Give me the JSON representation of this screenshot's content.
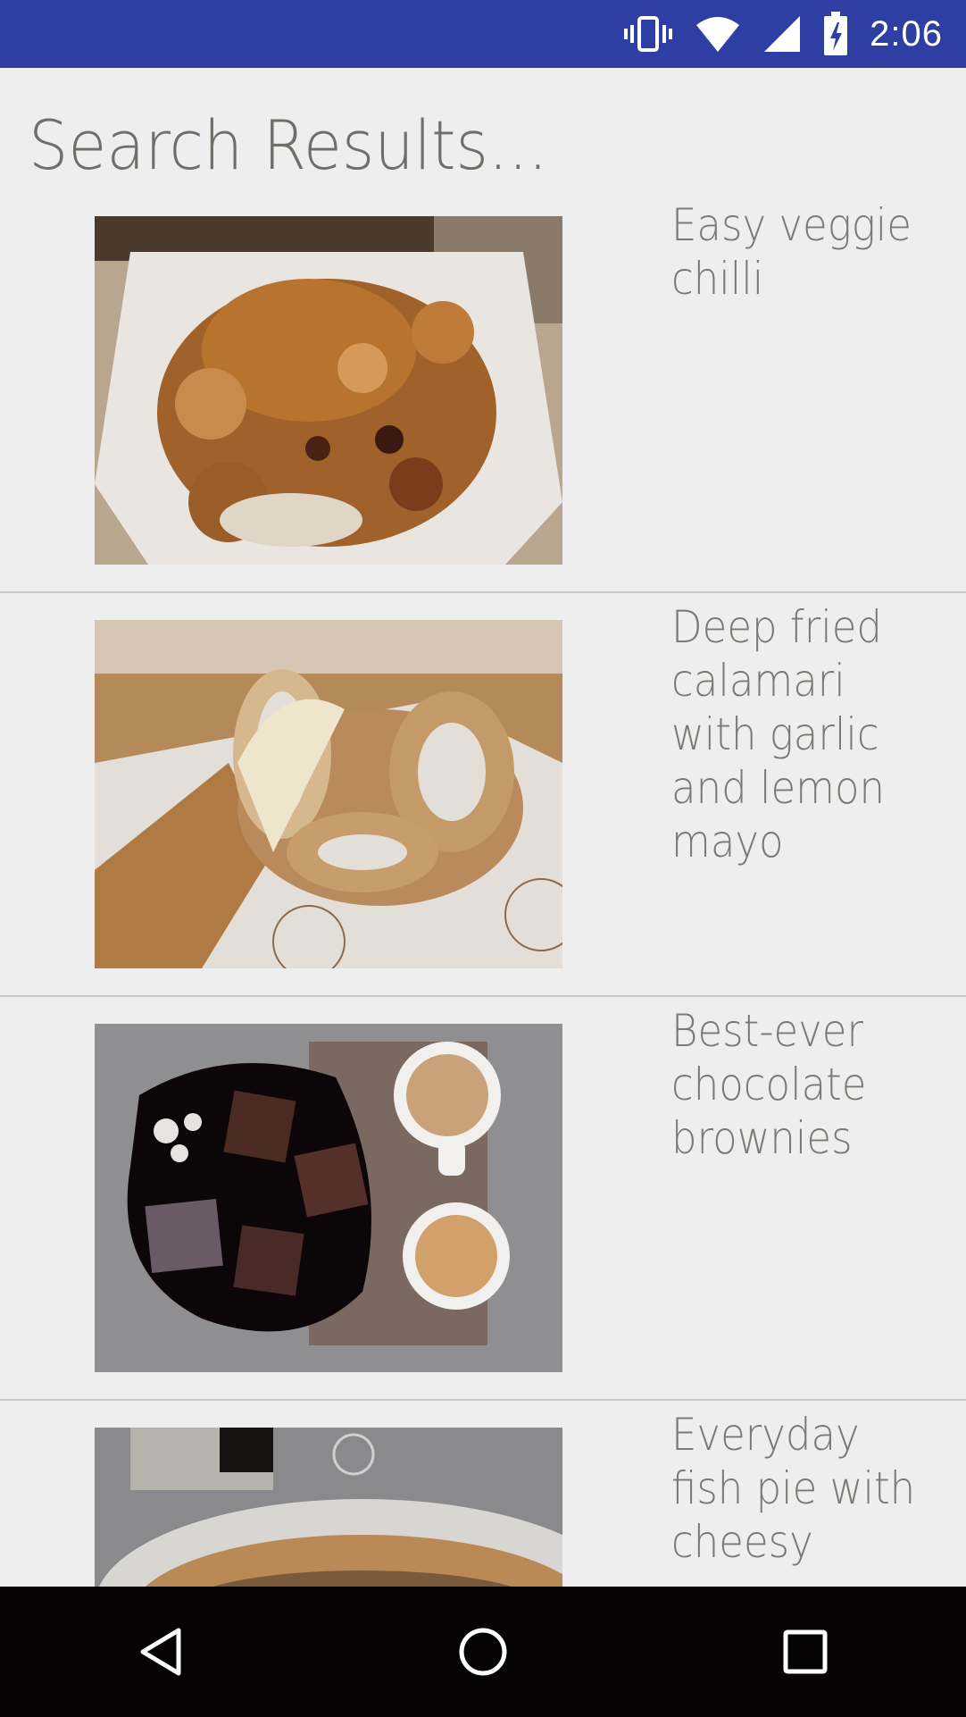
{
  "status_bar": {
    "time": "2:06",
    "icons": [
      "vibrate-icon",
      "wifi-icon",
      "signal-icon",
      "battery-charging-icon"
    ],
    "background_color": "#2f3ea3"
  },
  "page": {
    "title": "Search Results..."
  },
  "results": [
    {
      "title": "Easy veggie chilli",
      "image_icon": "food-photo-veggie-chilli"
    },
    {
      "title": "Deep fried calamari with garlic and lemon mayo",
      "image_icon": "food-photo-calamari"
    },
    {
      "title": "Best-ever chocolate brownies",
      "image_icon": "food-photo-brownies"
    },
    {
      "title": "Everyday fish pie with cheesy",
      "image_icon": "food-photo-fish-pie"
    }
  ],
  "nav_bar": {
    "buttons": [
      "back-icon",
      "home-icon",
      "recents-icon"
    ]
  },
  "colors": {
    "background": "#eeeeee",
    "title_text": "#6f6f69",
    "item_text": "#7a7a74",
    "divider": "#c9c9c9",
    "nav_bar": "#050303"
  }
}
